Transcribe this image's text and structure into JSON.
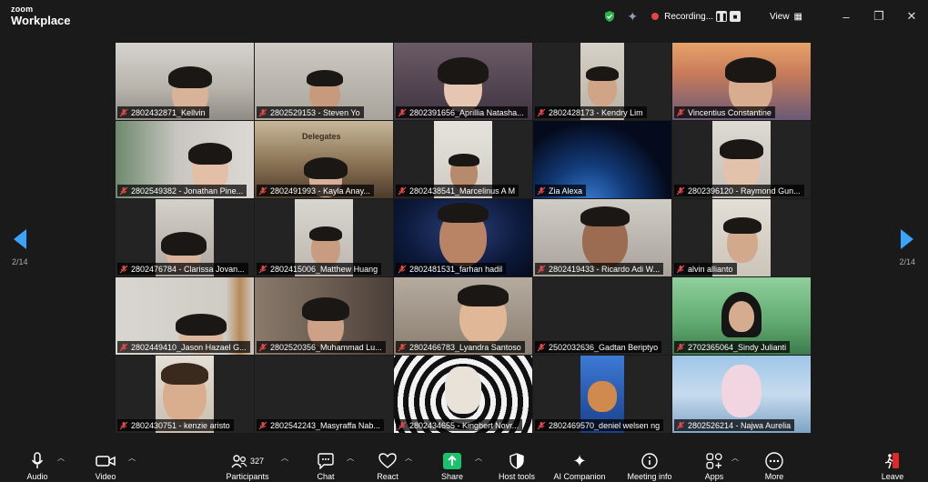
{
  "app": {
    "brand_small": "zoom",
    "brand_large": "Workplace"
  },
  "titlebar": {
    "recording_label": "Recording...",
    "pause_icon": "pause-icon",
    "stop_icon": "stop-icon",
    "view_label": "View",
    "colors": {
      "shield": "#2bb24c",
      "recording": "#e04646"
    }
  },
  "pagination": {
    "left": "2/14",
    "right": "2/14"
  },
  "participants": [
    {
      "name": "2802432871_Kellvin"
    },
    {
      "name": "2802529153 - Steven Yo"
    },
    {
      "name": "2802391656_Aprillia Natasha..."
    },
    {
      "name": "2802428173 - Kendry Lim"
    },
    {
      "name": "Vincentius Constantine"
    },
    {
      "name": "2802549382 - Jonathan Pine..."
    },
    {
      "name": "2802491993 - Kayla Anay..."
    },
    {
      "name": "2802438541_Marcelinus A M"
    },
    {
      "name": "Zia Alexa"
    },
    {
      "name": "2802396120 - Raymond Gun..."
    },
    {
      "name": "2802476784 - Clarissa Jovan..."
    },
    {
      "name": "2802415006_Matthew Huang"
    },
    {
      "name": "2802481531_farhan hadil"
    },
    {
      "name": "2802419433 - Ricardo Adi W..."
    },
    {
      "name": "alvin allianto"
    },
    {
      "name": "2802449410_Jason Hazael G..."
    },
    {
      "name": "2802520356_Muhammad Lu..."
    },
    {
      "name": "2802466783_Lyandra Santoso"
    },
    {
      "name": "2502032636_Gadtan Beriptyo"
    },
    {
      "name": "2702365064_Sindy Julianti"
    },
    {
      "name": "2802430751 - kenzie aristo"
    },
    {
      "name": "2802542243_Masyraffa Nab..."
    },
    {
      "name": "2802434655 - Kingbert Novr..."
    },
    {
      "name": "2802469570_deniel welsen ng"
    },
    {
      "name": "2802526214 - Najwa Aurelia"
    }
  ],
  "tile_extra": {
    "delegates_text": "Delegates"
  },
  "toolbar": {
    "audio": "Audio",
    "video": "Video",
    "participants": "Participants",
    "participants_count": "327",
    "chat": "Chat",
    "react": "React",
    "share": "Share",
    "host_tools": "Host tools",
    "ai_companion": "AI Companion",
    "meeting_info": "Meeting info",
    "apps": "Apps",
    "more": "More",
    "leave": "Leave",
    "colors": {
      "share": "#19c26b",
      "leave": "#e02828"
    }
  }
}
